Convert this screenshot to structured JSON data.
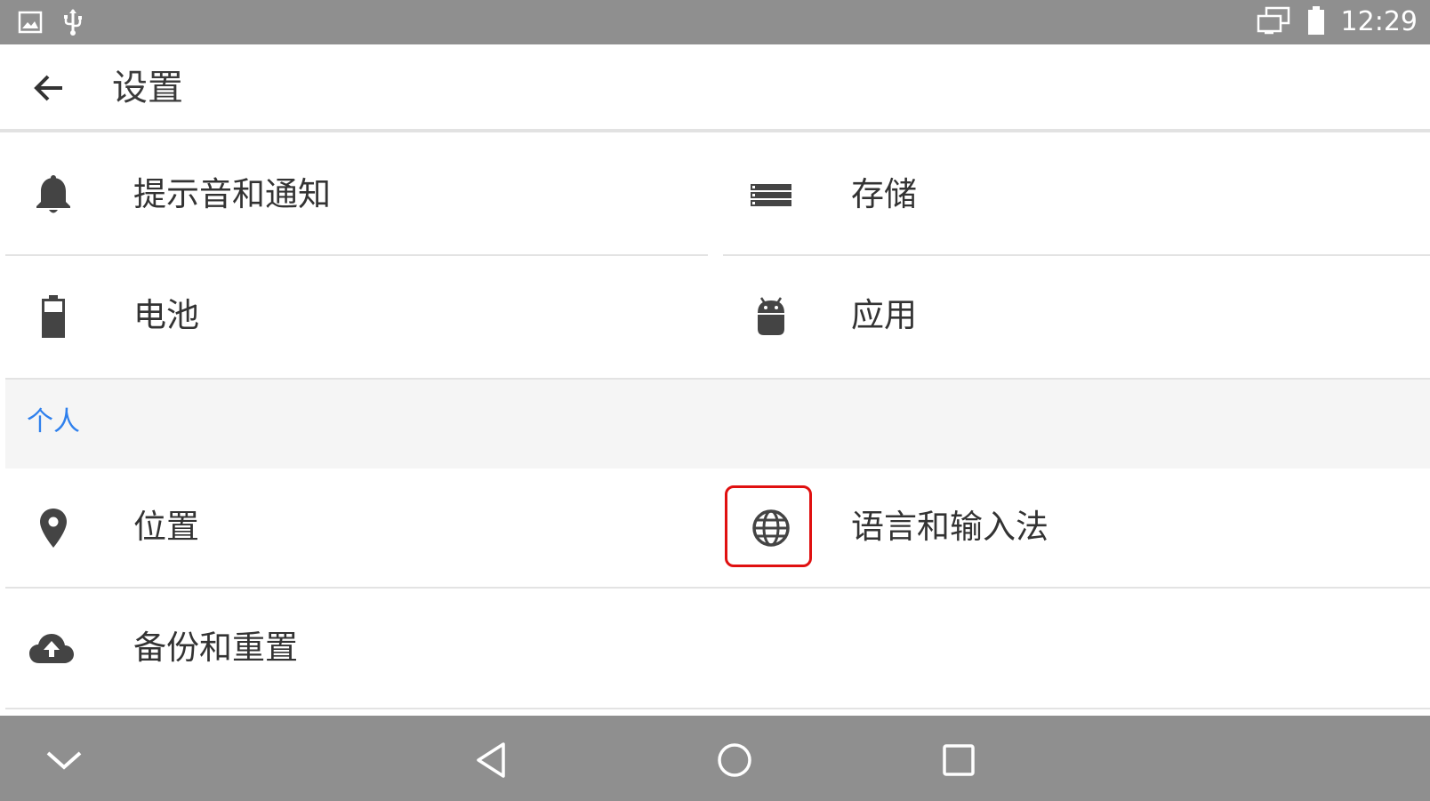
{
  "status_bar": {
    "time": "12:29",
    "left_icons": [
      "image-icon",
      "usb-icon"
    ],
    "right_icons": [
      "screen-cast-icon",
      "battery-icon"
    ]
  },
  "app_bar": {
    "title": "设置",
    "back_icon": "arrow-back-icon"
  },
  "items": {
    "notifications": {
      "label": "提示音和通知",
      "icon": "bell-icon"
    },
    "storage": {
      "label": "存储",
      "icon": "storage-icon"
    },
    "battery": {
      "label": "电池",
      "icon": "battery-icon"
    },
    "apps": {
      "label": "应用",
      "icon": "android-icon"
    },
    "location": {
      "label": "位置",
      "icon": "location-pin-icon"
    },
    "language": {
      "label": "语言和输入法",
      "icon": "globe-icon"
    },
    "backup": {
      "label": "备份和重置",
      "icon": "cloud-upload-icon"
    }
  },
  "sections": {
    "personal": "个人"
  },
  "nav_bar": {
    "icons": [
      "chevron-down-icon",
      "back-triangle-icon",
      "home-circle-icon",
      "recents-square-icon"
    ]
  },
  "colors": {
    "system_bar": "#8f8f8f",
    "section_header_text": "#2f80ed",
    "section_header_bg": "#f5f5f5",
    "icon": "#444444",
    "highlight": "#e01010"
  }
}
